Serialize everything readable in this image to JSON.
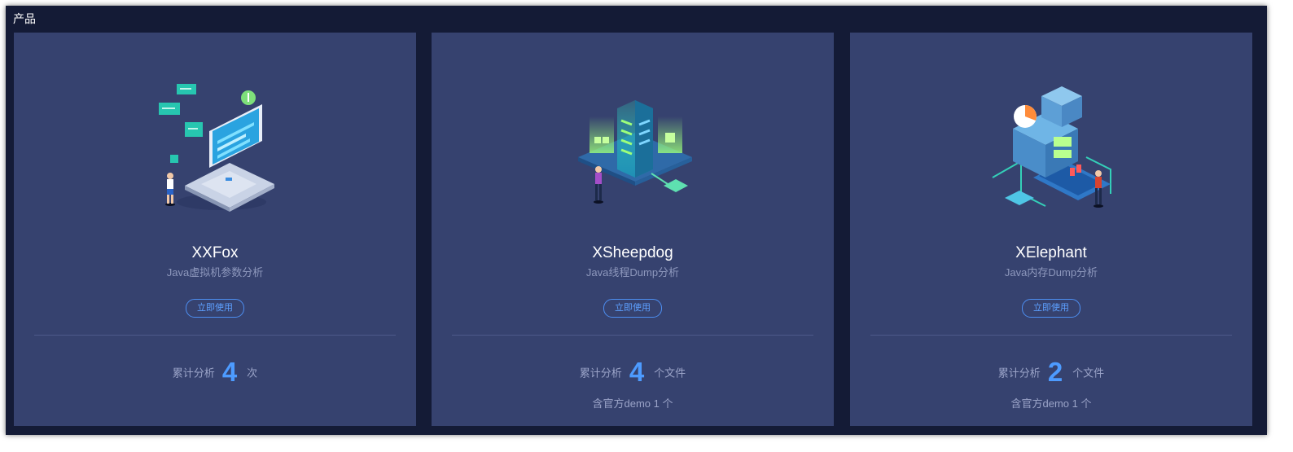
{
  "section": {
    "title": "产品"
  },
  "products": [
    {
      "name": "XXFox",
      "description": "Java虚拟机参数分析",
      "button_label": "立即使用",
      "stat_label": "累计分析",
      "stat_value": "4",
      "stat_unit": "次",
      "demo_note": "",
      "illustration": "laptop-chat-illustration"
    },
    {
      "name": "XSheepdog",
      "description": "Java线程Dump分析",
      "button_label": "立即使用",
      "stat_label": "累计分析",
      "stat_value": "4",
      "stat_unit": "个文件",
      "demo_note": "含官方demo 1 个",
      "illustration": "server-tower-illustration"
    },
    {
      "name": "XElephant",
      "description": "Java内存Dump分析",
      "button_label": "立即使用",
      "stat_label": "累计分析",
      "stat_value": "2",
      "stat_unit": "个文件",
      "demo_note": "含官方demo 1 个",
      "illustration": "memory-blocks-illustration"
    }
  ],
  "colors": {
    "page_bg": "#141b36",
    "card_bg": "#36426f",
    "accent": "#4d9bff",
    "muted_text": "#9ba4c8"
  }
}
